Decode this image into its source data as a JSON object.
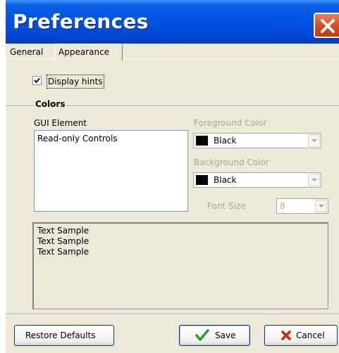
{
  "window": {
    "title": "Preferences"
  },
  "tabs": [
    {
      "label": "General"
    },
    {
      "label": "Appearance"
    }
  ],
  "display_hints": {
    "label": "Display hints",
    "checked": true
  },
  "colors": {
    "group_label": "Colors",
    "gui_element_label": "GUI Element",
    "gui_elements": [
      "Read-only Controls"
    ],
    "foreground_label": "Foreground Color",
    "foreground_value": "Black",
    "background_label": "Background Color",
    "background_value": "Black",
    "font_size_label": "Font Size",
    "font_size_value": "8"
  },
  "sample": {
    "lines": [
      "Text Sample",
      "Text Sample",
      "Text Sample"
    ]
  },
  "buttons": {
    "restore": "Restore Defaults",
    "save": "Save",
    "cancel": "Cancel"
  },
  "style": {
    "titlebar_color": "#0054e3",
    "close_color": "#d94e1f",
    "dialog_bg": "#ece9d8",
    "disabled_text": "#aca899"
  }
}
